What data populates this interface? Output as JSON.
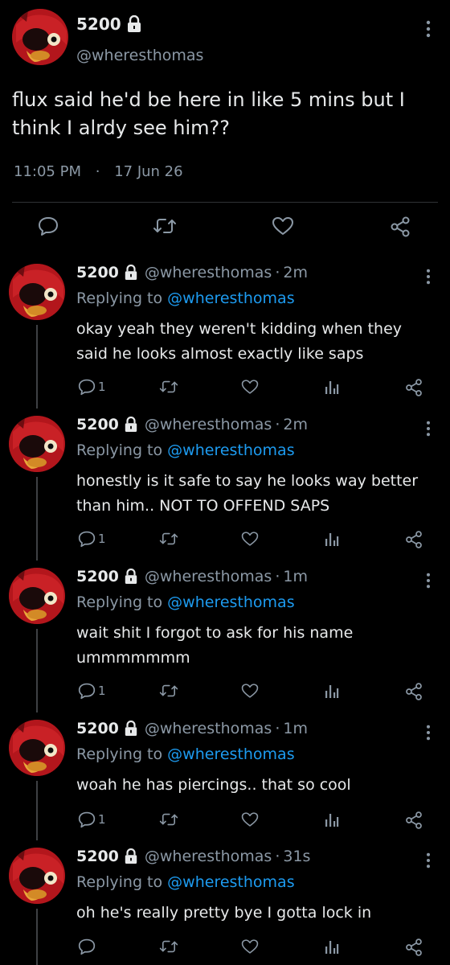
{
  "main_tweet": {
    "display_name": "5200",
    "handle": "@wheresthomas",
    "text": "flux said he'd be here in like 5 mins but I think I alrdy see him??",
    "time": "11:05 PM",
    "separator": "·",
    "date": "17 Jun 26"
  },
  "replies": [
    {
      "display_name": "5200",
      "handle": "@wheresthomas",
      "separator": "·",
      "age": "2m",
      "replying_prefix": "Replying to",
      "replying_to": "@wheresthomas",
      "text": "okay yeah they weren't kidding when they said he looks almost exactly like saps",
      "reply_count": "1"
    },
    {
      "display_name": "5200",
      "handle": "@wheresthomas",
      "separator": "·",
      "age": "2m",
      "replying_prefix": "Replying to",
      "replying_to": "@wheresthomas",
      "text": "honestly is it safe to say he looks way better than him.. NOT TO OFFEND SAPS",
      "reply_count": "1"
    },
    {
      "display_name": "5200",
      "handle": "@wheresthomas",
      "separator": "·",
      "age": "1m",
      "replying_prefix": "Replying to",
      "replying_to": "@wheresthomas",
      "text": "wait shit I forgot to ask for his name ummmmmmm",
      "reply_count": "1"
    },
    {
      "display_name": "5200",
      "handle": "@wheresthomas",
      "separator": "·",
      "age": "1m",
      "replying_prefix": "Replying to",
      "replying_to": "@wheresthomas",
      "text": "woah he has piercings.. that so cool",
      "reply_count": "1"
    },
    {
      "display_name": "5200",
      "handle": "@wheresthomas",
      "separator": "·",
      "age": "31s",
      "replying_prefix": "Replying to",
      "replying_to": "@wheresthomas",
      "text": "oh he's really pretty bye I gotta lock in",
      "reply_count": ""
    }
  ],
  "icons": {
    "lock": "lock-icon",
    "more": "more-vertical-icon",
    "reply": "reply-bubble-icon",
    "retweet": "retweet-icon",
    "like": "heart-icon",
    "analytics": "analytics-bars-icon",
    "share": "share-icon"
  },
  "colors": {
    "background": "#000000",
    "text": "#e7e9ea",
    "secondary": "#8b98a5",
    "link": "#1d9bf0",
    "divider": "#2f3336"
  }
}
